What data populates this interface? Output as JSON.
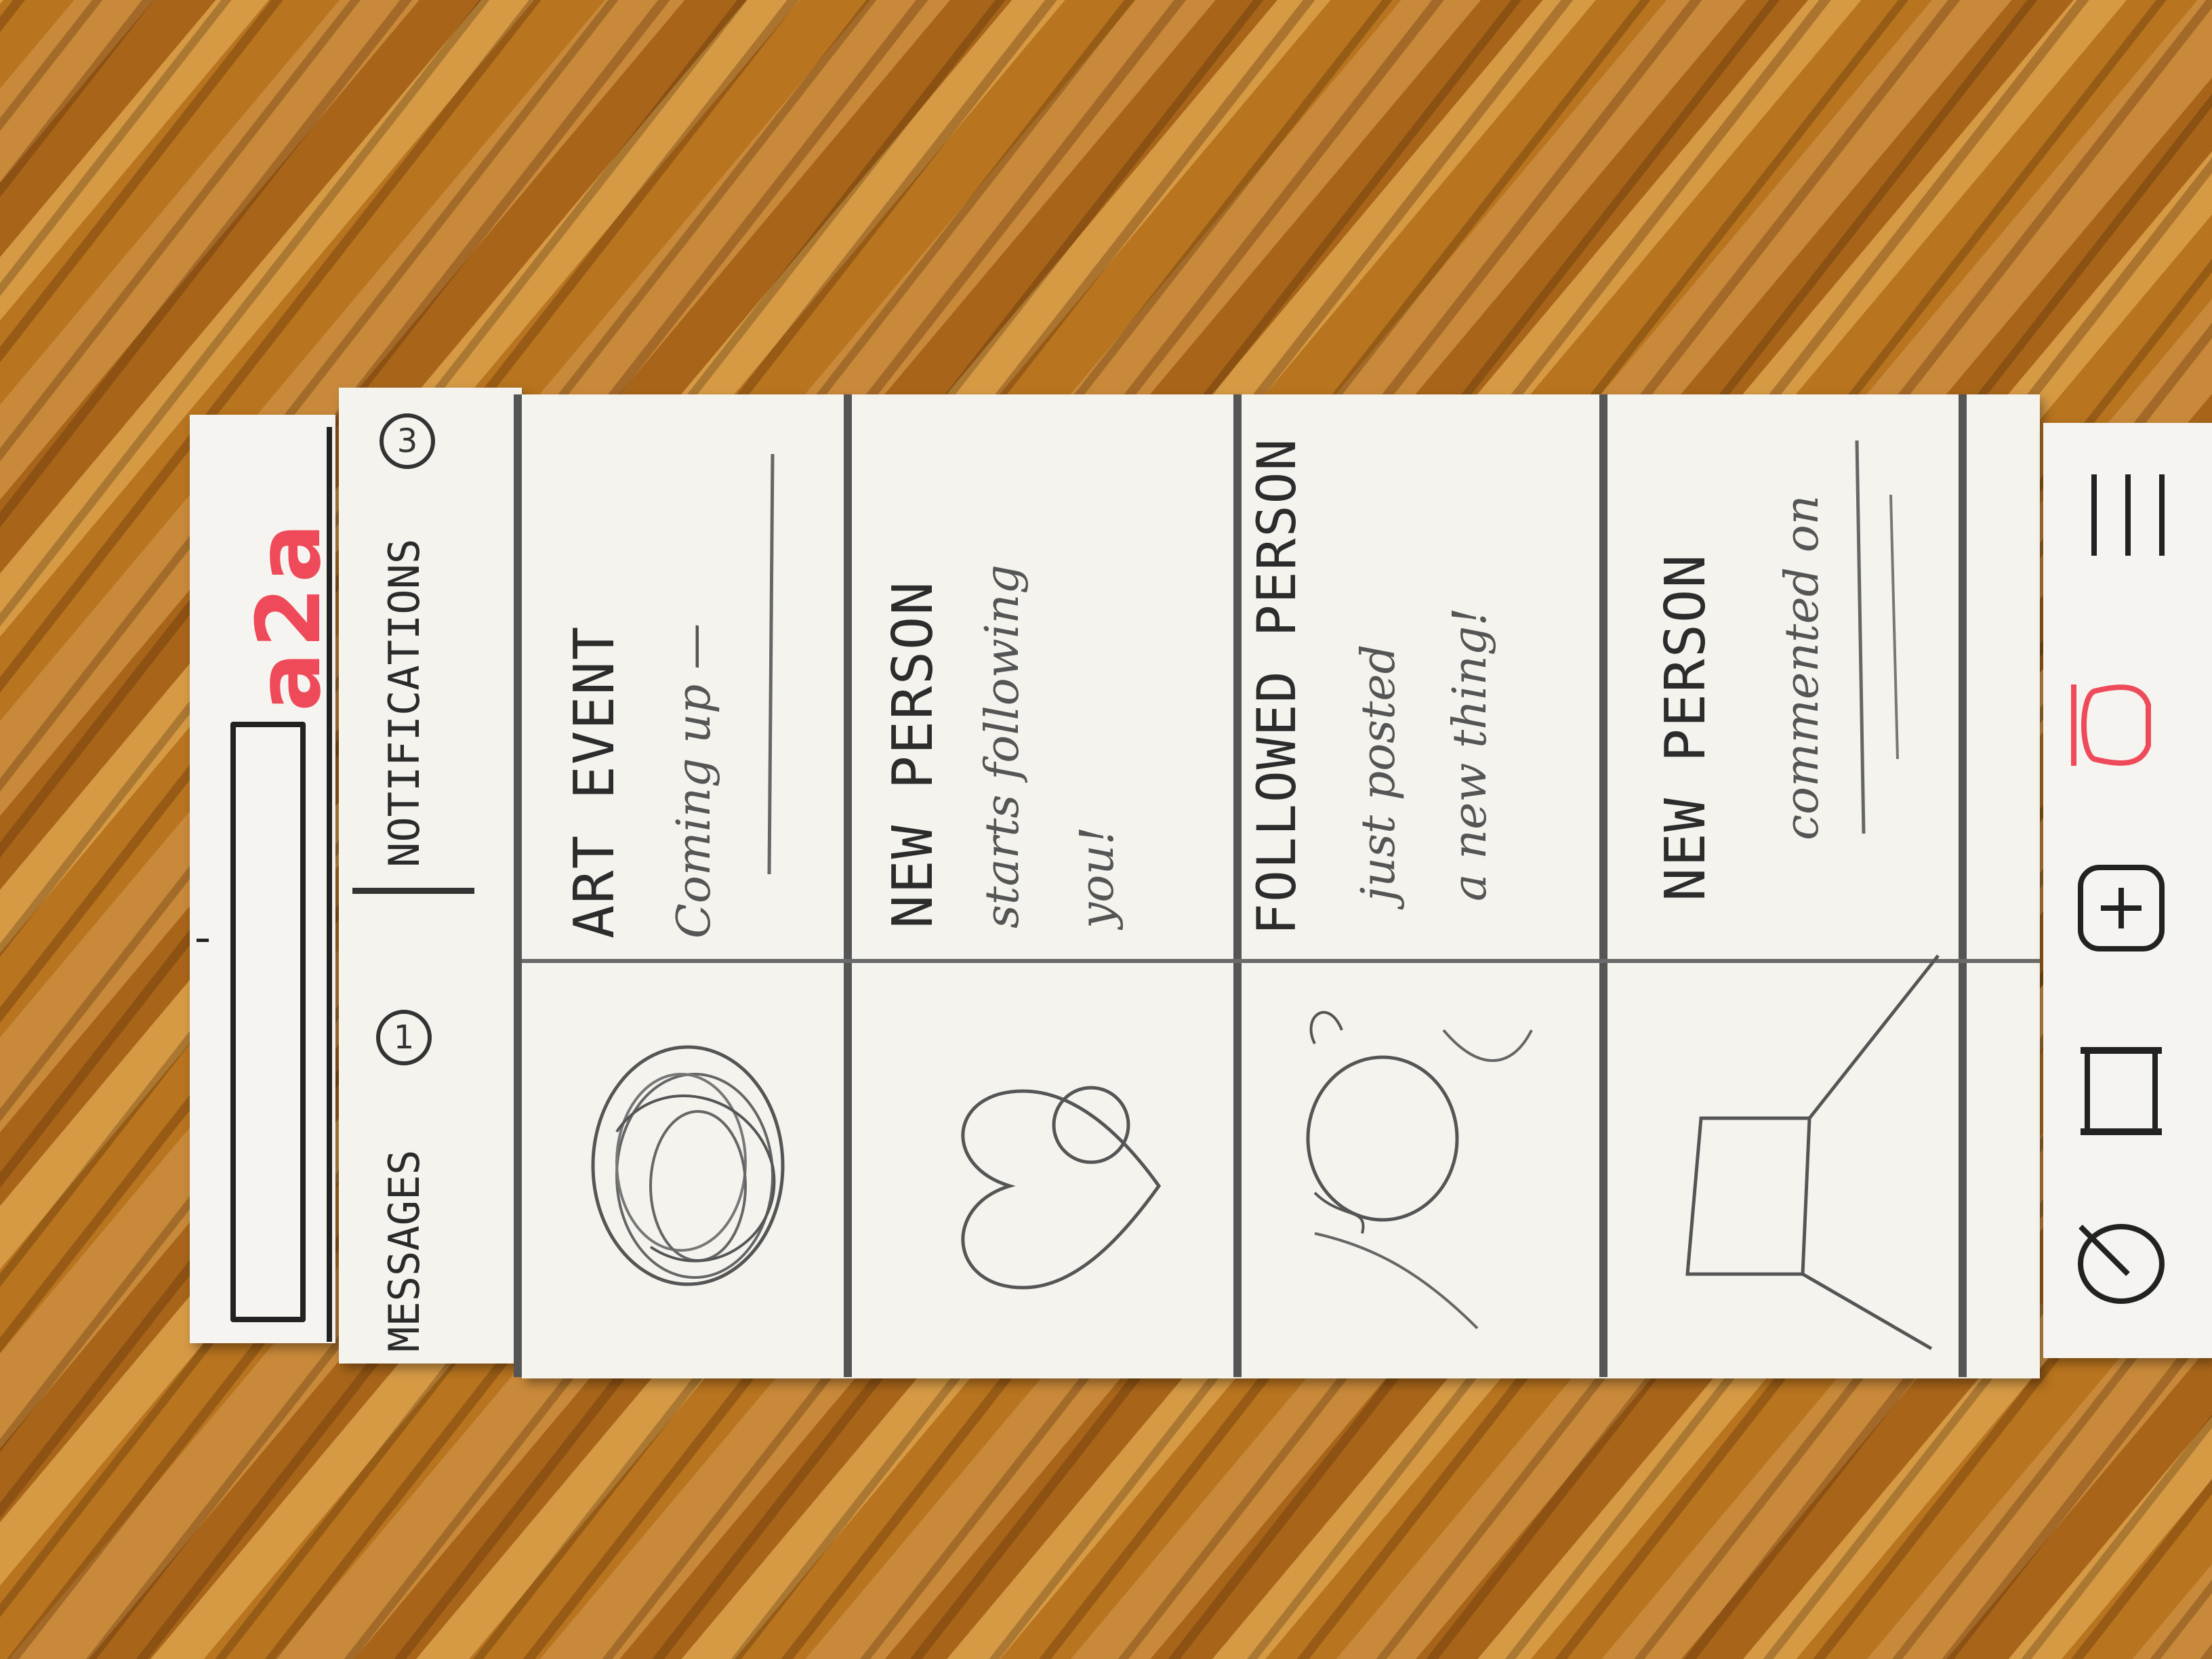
{
  "header": {
    "logo": "a2a",
    "logo_color": "#ef4a5a"
  },
  "tabs": {
    "messages_label": "MESSAGES",
    "messages_count": "1",
    "notifications_label": "NOTIFICATIONS",
    "notifications_count": "3"
  },
  "notifications": [
    {
      "title": "ART EVENT",
      "line1": "Coming up —",
      "line2": "",
      "thumb_icon": "scribble-circle-icon"
    },
    {
      "title": "NEW PERSON",
      "line1": "starts following",
      "line2": "you!",
      "thumb_icon": "heart-profile-icon"
    },
    {
      "title": "FOLLOWED PERSON",
      "line1": "just posted",
      "line2": "a new thing!",
      "thumb_icon": "scribble-animal-icon"
    },
    {
      "title": "NEW PERSON",
      "line1": "commented on",
      "line2": "",
      "thumb_icon": "picture-frame-icon"
    }
  ],
  "nav": {
    "items": [
      "palette-icon",
      "scroll-icon",
      "add-icon",
      "bell-icon",
      "menu-icon"
    ],
    "active_item": "bell-icon",
    "active_color": "#ef4a5a"
  }
}
